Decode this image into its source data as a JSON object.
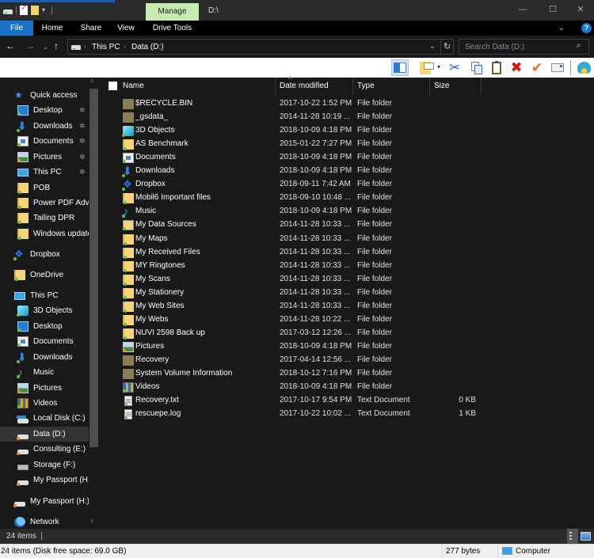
{
  "titlebar": {
    "context_tab": "Manage",
    "path": "D:\\",
    "minimize": "—",
    "maximize": "☐",
    "close": "✕"
  },
  "ribbon": {
    "tabs": [
      "File",
      "Home",
      "Share",
      "View",
      "Drive Tools"
    ],
    "expand_icon": "⌄",
    "help_icon": "?"
  },
  "address": {
    "back": "←",
    "forward": "→",
    "recent": "⌄",
    "up": "↑",
    "crumbs": [
      "This PC",
      "Data (D:)"
    ],
    "crumb_sep": "›",
    "dropdown": "⌄",
    "refresh": "↻",
    "search_placeholder": "Search Data (D:)",
    "search_icon": "⌕"
  },
  "toolbar": {
    "cut_glyph": "✂",
    "delete_glyph": "✖",
    "check_glyph": "✔",
    "dropdown_glyph": "▾"
  },
  "navpane": {
    "pin_glyph": "✲",
    "items": [
      {
        "label": "Quick access",
        "icon": "star",
        "indent": 0
      },
      {
        "label": "Desktop",
        "icon": "desktop",
        "indent": 1,
        "pinned": true
      },
      {
        "label": "Downloads",
        "icon": "downloads",
        "indent": 1,
        "pinned": true
      },
      {
        "label": "Documents",
        "icon": "documents",
        "indent": 1,
        "pinned": true
      },
      {
        "label": "Pictures",
        "icon": "pictures",
        "indent": 1,
        "pinned": true
      },
      {
        "label": "This PC",
        "icon": "pc",
        "indent": 1,
        "pinned": true
      },
      {
        "label": "POB",
        "icon": "folder",
        "indent": 1
      },
      {
        "label": "Power PDF Advanced",
        "icon": "folder",
        "indent": 1
      },
      {
        "label": "Tailing DPR",
        "icon": "folder",
        "indent": 1
      },
      {
        "label": "Windows update",
        "icon": "folder",
        "indent": 1
      },
      {
        "label": "Dropbox",
        "icon": "dropbox",
        "indent": 0
      },
      {
        "label": "OneDrive",
        "icon": "folder",
        "indent": 0
      },
      {
        "label": "This PC",
        "icon": "pc",
        "indent": 0
      },
      {
        "label": "3D Objects",
        "icon": "3d",
        "indent": 1
      },
      {
        "label": "Desktop",
        "icon": "desktop",
        "indent": 1
      },
      {
        "label": "Documents",
        "icon": "documents",
        "indent": 1
      },
      {
        "label": "Downloads",
        "icon": "downloads",
        "indent": 1
      },
      {
        "label": "Music",
        "icon": "music",
        "indent": 1
      },
      {
        "label": "Pictures",
        "icon": "pictures",
        "indent": 1
      },
      {
        "label": "Videos",
        "icon": "videos",
        "indent": 1
      },
      {
        "label": "Local Disk (C:)",
        "icon": "drive-sys",
        "indent": 1
      },
      {
        "label": "Data (D:)",
        "icon": "drive",
        "indent": 1,
        "selected": true
      },
      {
        "label": "Consulting (E:)",
        "icon": "drive",
        "indent": 1
      },
      {
        "label": "Storage (F:)",
        "icon": "drive-ext",
        "indent": 1
      },
      {
        "label": "My Passport (H:)",
        "icon": "drive",
        "indent": 1
      },
      {
        "label": "My Passport (H:)",
        "icon": "drive",
        "indent": 0
      },
      {
        "label": "Network",
        "icon": "network",
        "indent": 0
      }
    ]
  },
  "filelist": {
    "columns": {
      "name": "Name",
      "date": "Date modified",
      "type": "Type",
      "size": "Size"
    },
    "sort_glyph": "˄",
    "rows": [
      {
        "name": "$RECYCLE.BIN",
        "date": "2017-10-22 1:52 PM",
        "type": "File folder",
        "size": "",
        "icon": "sysfolder"
      },
      {
        "name": "_gsdata_",
        "date": "2014-11-28 10:19 ...",
        "type": "File folder",
        "size": "",
        "icon": "sysfolder"
      },
      {
        "name": "3D Objects",
        "date": "2018-10-09 4:18 PM",
        "type": "File folder",
        "size": "",
        "icon": "3d"
      },
      {
        "name": "AS Benchmark",
        "date": "2015-01-22 7:27 PM",
        "type": "File folder",
        "size": "",
        "icon": "folder"
      },
      {
        "name": "Documents",
        "date": "2018-10-09 4:18 PM",
        "type": "File folder",
        "size": "",
        "icon": "documents"
      },
      {
        "name": "Downloads",
        "date": "2018-10-09 4:18 PM",
        "type": "File folder",
        "size": "",
        "icon": "downloads"
      },
      {
        "name": "Dropbox",
        "date": "2018-09-11 7:42 AM",
        "type": "File folder",
        "size": "",
        "icon": "dropbox"
      },
      {
        "name": "Mobil6 Important files",
        "date": "2018-09-10 10:48 ...",
        "type": "File folder",
        "size": "",
        "icon": "folder"
      },
      {
        "name": "Music",
        "date": "2018-10-09 4:18 PM",
        "type": "File folder",
        "size": "",
        "icon": "music"
      },
      {
        "name": "My Data Sources",
        "date": "2014-11-28 10:33 ...",
        "type": "File folder",
        "size": "",
        "icon": "datasrc"
      },
      {
        "name": "My Maps",
        "date": "2014-11-28 10:33 ...",
        "type": "File folder",
        "size": "",
        "icon": "folder"
      },
      {
        "name": "My Received Files",
        "date": "2014-11-28 10:33 ...",
        "type": "File folder",
        "size": "",
        "icon": "folder"
      },
      {
        "name": "MY Ringtones",
        "date": "2014-11-28 10:33 ...",
        "type": "File folder",
        "size": "",
        "icon": "folder"
      },
      {
        "name": "My Scans",
        "date": "2014-11-28 10:33 ...",
        "type": "File folder",
        "size": "",
        "icon": "folder"
      },
      {
        "name": "My Stationery",
        "date": "2014-11-28 10:33 ...",
        "type": "File folder",
        "size": "",
        "icon": "folder"
      },
      {
        "name": "My Web Sites",
        "date": "2014-11-28 10:33 ...",
        "type": "File folder",
        "size": "",
        "icon": "folder"
      },
      {
        "name": "My Webs",
        "date": "2014-11-28 10:22 ...",
        "type": "File folder",
        "size": "",
        "icon": "folder"
      },
      {
        "name": "NUVI 2598 Back up",
        "date": "2017-03-12 12:26 ...",
        "type": "File folder",
        "size": "",
        "icon": "folder"
      },
      {
        "name": "Pictures",
        "date": "2018-10-09 4:18 PM",
        "type": "File folder",
        "size": "",
        "icon": "pictures"
      },
      {
        "name": "Recovery",
        "date": "2017-04-14 12:56 ...",
        "type": "File folder",
        "size": "",
        "icon": "sysfolder"
      },
      {
        "name": "System Volume Information",
        "date": "2018-10-12 7:16 PM",
        "type": "File folder",
        "size": "",
        "icon": "sysfolder"
      },
      {
        "name": "Videos",
        "date": "2018-10-09 4:18 PM",
        "type": "File folder",
        "size": "",
        "icon": "videos"
      },
      {
        "name": "Recovery.txt",
        "date": "2017-10-17 9:54 PM",
        "type": "Text Document",
        "size": "0 KB",
        "icon": "txt"
      },
      {
        "name": "rescuepe.log",
        "date": "2017-10-22 10:02 ...",
        "type": "Text Document",
        "size": "1 KB",
        "icon": "txt"
      }
    ]
  },
  "statusbar": {
    "item_count": "24 items"
  },
  "sysbar": {
    "summary": "24 items (Disk free space: 69.0 GB)",
    "size": "277 bytes",
    "location": "Computer"
  }
}
